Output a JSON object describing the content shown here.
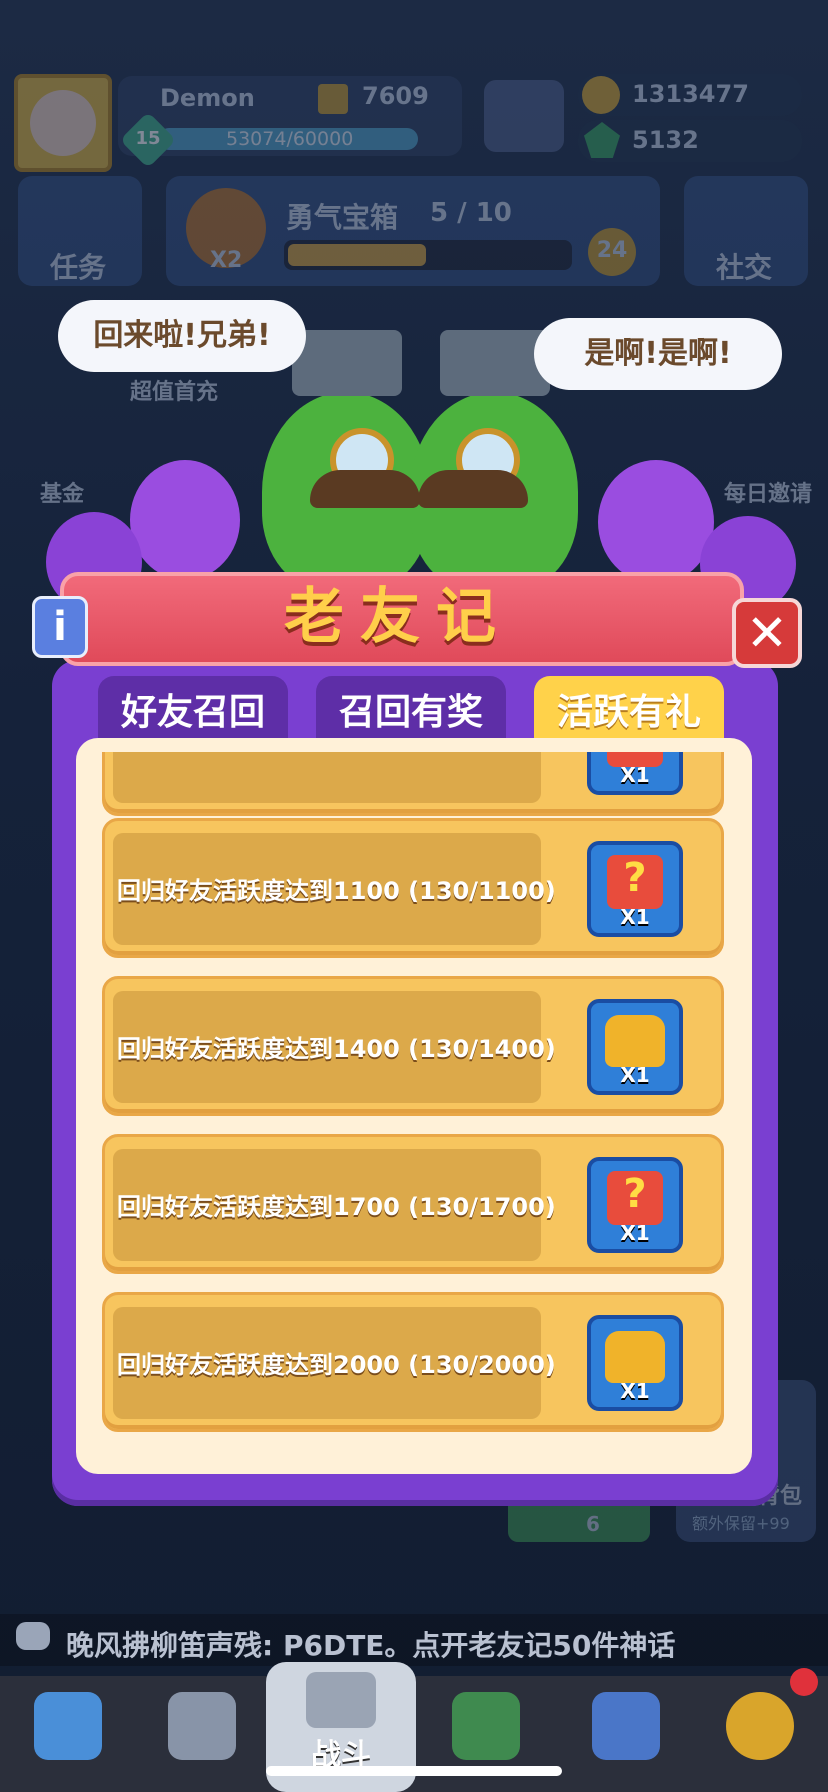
{
  "player": {
    "name": "Demon",
    "trophies": "7609",
    "level": "15",
    "xp": "53074/60000",
    "gold": "1313477",
    "gems": "5132"
  },
  "hud": {
    "tasks_label": "任务",
    "chest_title": "勇气宝箱",
    "chest_progress": "5 / 10",
    "chest_multiplier": "X2",
    "chest_timer": "24",
    "social_label": "社交",
    "side_left": [
      "超值首充",
      "基金"
    ],
    "side_right": [
      "每日邀请"
    ]
  },
  "speech": {
    "left": "回来啦!兄弟!",
    "right": "是啊!是啊!"
  },
  "dialog": {
    "title": "老友记",
    "tabs": [
      {
        "label": "好友召回",
        "active": false
      },
      {
        "label": "召回有奖",
        "active": false
      },
      {
        "label": "活跃有礼",
        "active": true
      }
    ],
    "partial_row_count": "X1",
    "rows": [
      {
        "text": "回归好友活跃度达到1100 (130/1100)",
        "reward": "mystery-box",
        "count": "X1"
      },
      {
        "text": "回归好友活跃度达到1400 (130/1400)",
        "reward": "golden-chest",
        "count": "X1"
      },
      {
        "text": "回归好友活跃度达到1700 (130/1700)",
        "reward": "mystery-box",
        "count": "X1"
      },
      {
        "text": "回归好友活跃度达到2000 (130/2000)",
        "reward": "golden-chest",
        "count": "X1"
      }
    ]
  },
  "background_bits": {
    "shop_gem_count": "6",
    "bag_label": "背包",
    "bag_sub": "额外保留+99"
  },
  "ticker": "晚风拂柳笛声残: P6DTE。点开老友记50件神话",
  "nav": {
    "battle_label": "战斗"
  },
  "colors": {
    "dialog_purple": "#7a3fd1",
    "ribbon_red": "#e04a5a",
    "title_gold": "#ffcf4a",
    "row_gold": "#f7c55e",
    "close_red": "#d63a3a"
  }
}
